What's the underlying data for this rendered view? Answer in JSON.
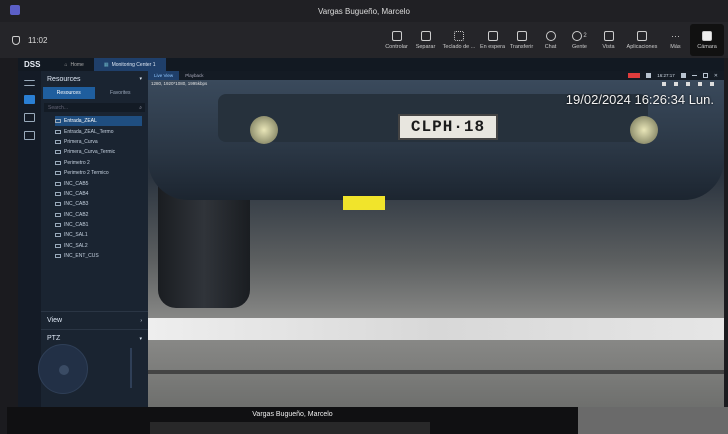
{
  "teams": {
    "window_title": "Vargas Bugueño, Marcelo",
    "call_time": "11:02",
    "tools": [
      {
        "label": "Controlar",
        "icon": "control-icon"
      },
      {
        "label": "Separar",
        "icon": "popout-icon"
      },
      {
        "label": "Teclado de ...",
        "icon": "dialpad-icon"
      },
      {
        "label": "En espera",
        "icon": "hold-icon"
      },
      {
        "label": "Transferir",
        "icon": "transfer-icon"
      },
      {
        "label": "Chat",
        "icon": "chat-icon"
      },
      {
        "label": "Gente",
        "icon": "people-icon"
      },
      {
        "label": "Vista",
        "icon": "view-icon"
      },
      {
        "label": "Aplicaciones",
        "icon": "apps-icon"
      },
      {
        "label": "Más",
        "icon": "more-icon"
      },
      {
        "label": "Cámara",
        "icon": "camera-icon"
      }
    ],
    "people_count": "2"
  },
  "dss": {
    "logo": "DSS",
    "tabs": [
      "Home",
      "Monitoring Center 1"
    ],
    "resources_title": "Resources",
    "resources_tabs": [
      "Resources",
      "Favorites"
    ],
    "search_placeholder": "Search...",
    "items": [
      {
        "label": "Entrada_ZEAL",
        "selected": true
      },
      {
        "label": "Entrada_ZEAL_Termo",
        "selected": false
      },
      {
        "label": "Primera_Curva",
        "selected": false
      },
      {
        "label": "Primera_Curva_Termic",
        "selected": false
      },
      {
        "label": "Perimetro 2",
        "selected": false
      },
      {
        "label": "Perimetro 2 Termico",
        "selected": false
      },
      {
        "label": "INC_CAB5",
        "selected": false
      },
      {
        "label": "INC_CAB4",
        "selected": false
      },
      {
        "label": "INC_CAB3",
        "selected": false
      },
      {
        "label": "INC_CAB2",
        "selected": false
      },
      {
        "label": "INC_CAB1",
        "selected": false
      },
      {
        "label": "INC_SAL1",
        "selected": false
      },
      {
        "label": "INC_SAL2",
        "selected": false
      },
      {
        "label": "INC_ENT_CUS",
        "selected": false
      }
    ],
    "view_label": "View",
    "ptz_label": "PTZ",
    "video_tabs": [
      "Live View",
      "Playback"
    ],
    "clock": "16:27:17",
    "video": {
      "resolution_label": "1280, 1920*1080, 1995kbps",
      "osd_timestamp": "19/02/2024 16:26:34 Lun.",
      "plate_text": "CLPH·18"
    }
  },
  "shared_bar": {
    "name": "Vargas Bugueño, Marcelo"
  }
}
